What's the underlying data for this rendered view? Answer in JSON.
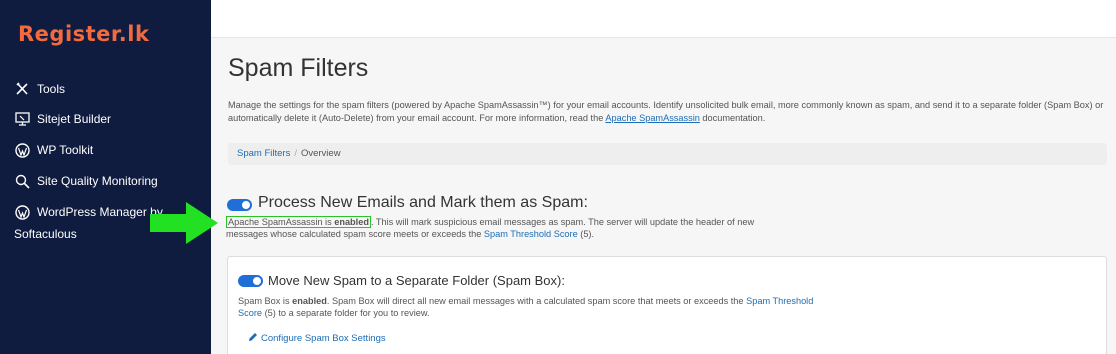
{
  "brand": {
    "logo_text": "Register.lk",
    "logo_color": "#f26a3d"
  },
  "sidebar": {
    "items": [
      {
        "label": "Tools",
        "icon": "tools-icon"
      },
      {
        "label": "Sitejet Builder",
        "icon": "sitejet-icon"
      },
      {
        "label": "WP Toolkit",
        "icon": "wordpress-icon"
      },
      {
        "label": "Site Quality Monitoring",
        "icon": "search-icon"
      },
      {
        "label": "WordPress Manager by",
        "label_line2": "Softaculous",
        "icon": "wordpress-icon"
      }
    ]
  },
  "page": {
    "title": "Spam Filters",
    "description_text": "Manage the settings for the spam filters (powered by Apache SpamAssassin™) for your email accounts. Identify unsolicited bulk email, more commonly known as spam, and send it to a separate folder (Spam Box) or automatically delete it (Auto-Delete) from your email account. For more information, read the",
    "description_link": "Apache SpamAssassin",
    "description_tail": "documentation."
  },
  "breadcrumb": {
    "link": "Spam Filters",
    "separator": "/",
    "current": "Overview"
  },
  "process_section": {
    "title": "Process New Emails and Mark them as Spam:",
    "toggle_on": true,
    "status_prefix": "Apache SpamAssassin is ",
    "status_state": "enabled",
    "status_suffix": ". This will mark suspicious email messages as spam. The server will update the header of new messages whose calculated spam score meets or exceeds the",
    "threshold_link": "Spam Threshold Score",
    "threshold_value": "(5)."
  },
  "spam_box": {
    "title": "Move New Spam to a Separate Folder (Spam Box):",
    "toggle_on": true,
    "text_prefix": "Spam Box is ",
    "text_state": "enabled",
    "text_suffix": ". Spam Box will direct all new email messages with a calculated spam score that meets or exceeds the",
    "threshold_link": "Spam Threshold Score",
    "text_tail": "(5) to a separate folder for you to review.",
    "configure_link": "Configure Spam Box Settings"
  },
  "colors": {
    "sidebar_bg": "#0f1c3f",
    "link": "#1c6db7",
    "toggle": "#1f6fd6",
    "highlight": "#28c428",
    "arrow": "#22e022"
  }
}
